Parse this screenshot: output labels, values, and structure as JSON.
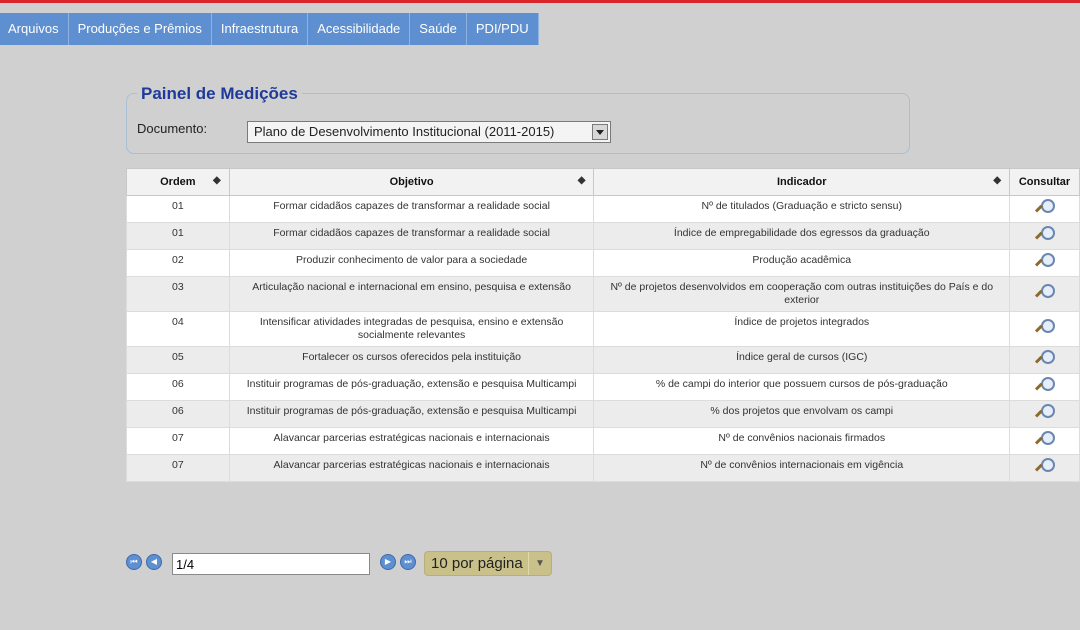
{
  "colors": {
    "accent": "#5e8fd1",
    "title": "#1f3a9a",
    "top_line": "#d8262b"
  },
  "nav": [
    "Arquivos",
    "Produções e Prêmios",
    "Infraestrutura",
    "Acessibilidade",
    "Saúde",
    "PDI/PDU"
  ],
  "panel": {
    "title": "Painel de Medições",
    "document_label": "Documento:",
    "document_value": "Plano de Desenvolvimento Institucional (2011-2015)"
  },
  "table": {
    "headers": {
      "ordem": "Ordem",
      "objetivo": "Objetivo",
      "indicador": "Indicador",
      "consultar": "Consultar"
    },
    "sort_icon": "sort-icon",
    "rows": [
      {
        "ordem": "01",
        "objetivo": "Formar cidadãos capazes de transformar a realidade social",
        "indicador": "Nº de titulados (Graduação e stricto sensu)"
      },
      {
        "ordem": "01",
        "objetivo": "Formar cidadãos capazes de transformar a realidade social",
        "indicador": "Índice de empregabilidade dos egressos da graduação"
      },
      {
        "ordem": "02",
        "objetivo": "Produzir conhecimento de valor para a sociedade",
        "indicador": "Produção acadêmica"
      },
      {
        "ordem": "03",
        "objetivo": "Articulação nacional e internacional em ensino, pesquisa e extensão",
        "indicador": "Nº de projetos desenvolvidos em cooperação com outras instituições do País e do exterior"
      },
      {
        "ordem": "04",
        "objetivo": "Intensificar atividades integradas de pesquisa, ensino e extensão socialmente relevantes",
        "indicador": "Índice de projetos integrados"
      },
      {
        "ordem": "05",
        "objetivo": "Fortalecer os cursos oferecidos pela instituição",
        "indicador": "Índice geral de cursos (IGC)"
      },
      {
        "ordem": "06",
        "objetivo": "Instituir programas de pós-graduação, extensão e pesquisa Multicampi",
        "indicador": "% de campi do interior que possuem cursos de pós-graduação"
      },
      {
        "ordem": "06",
        "objetivo": "Instituir programas de pós-graduação, extensão e pesquisa Multicampi",
        "indicador": "% dos projetos que envolvam os campi"
      },
      {
        "ordem": "07",
        "objetivo": "Alavancar parcerias estratégicas nacionais e internacionais",
        "indicador": "Nº de convênios nacionais firmados"
      },
      {
        "ordem": "07",
        "objetivo": "Alavancar parcerias estratégicas nacionais e internacionais",
        "indicador": "Nº de convênios internacionais em vigência"
      }
    ]
  },
  "pager": {
    "page_value": "1/4",
    "per_page": "10 por página"
  }
}
